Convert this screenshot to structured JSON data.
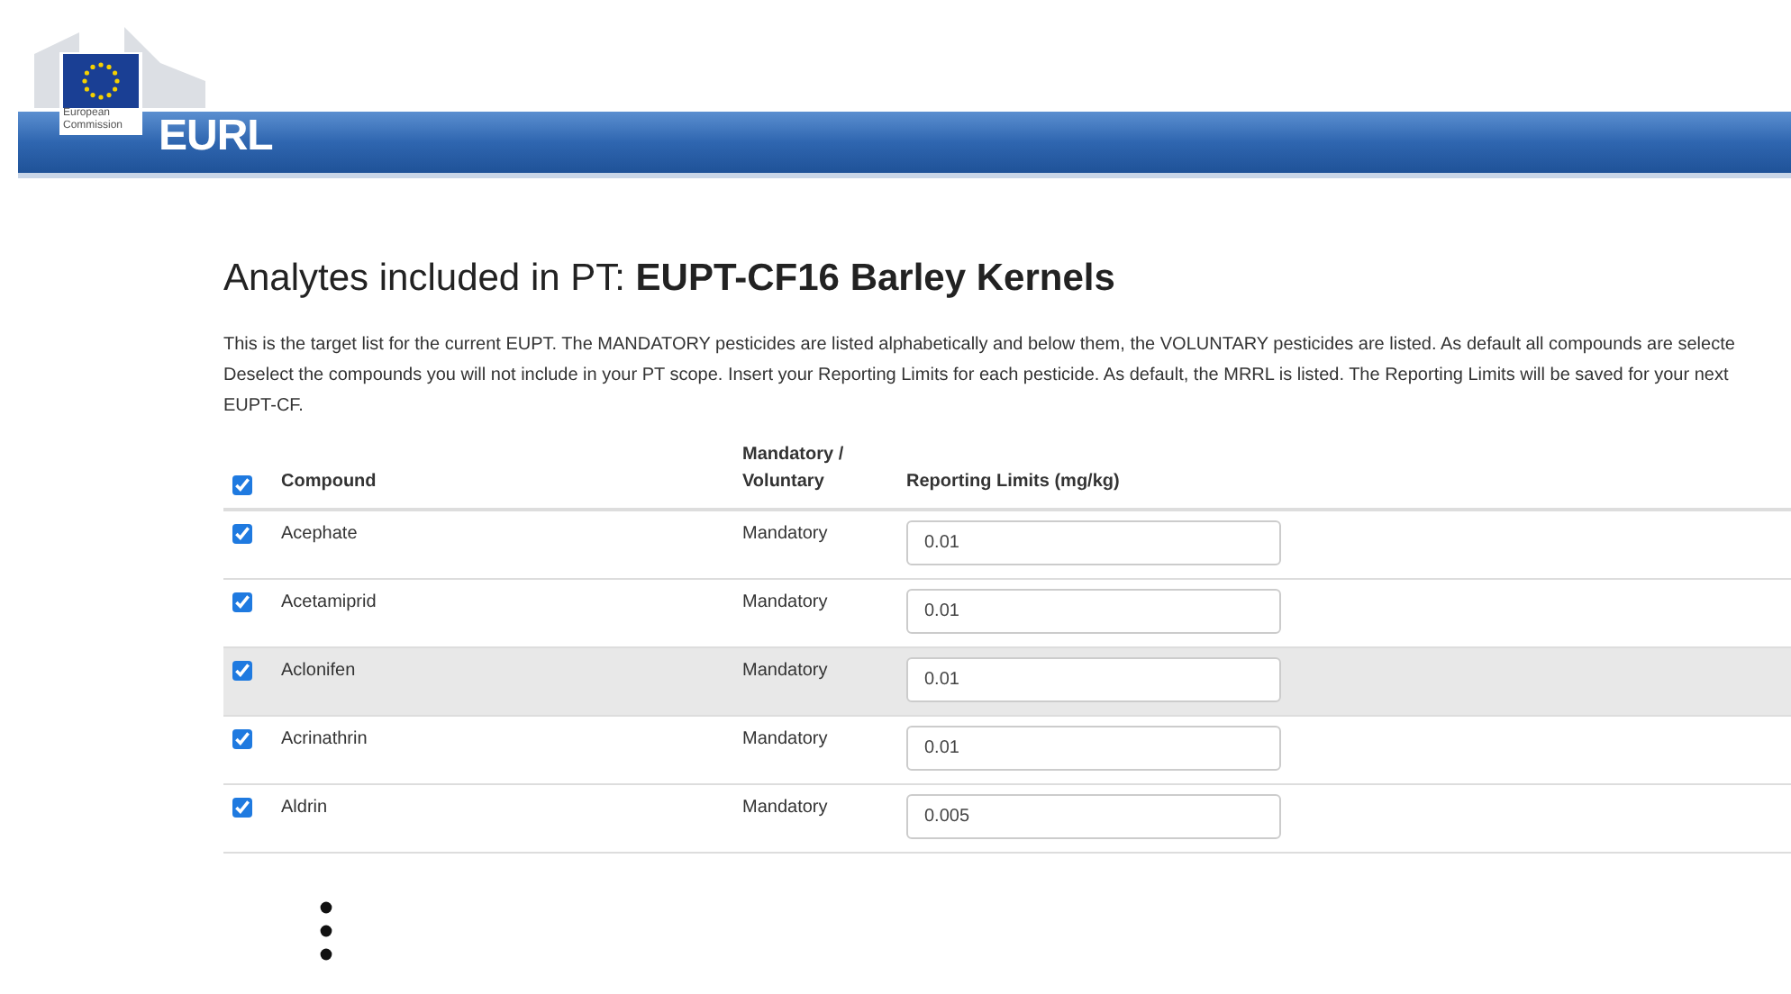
{
  "header": {
    "logo_caption": "European Commission",
    "brand": "EURL"
  },
  "title": {
    "prefix": "Analytes included in PT: ",
    "name": "EUPT-CF16 Barley Kernels"
  },
  "intro_lines": [
    "This is the target list for the current EUPT. The MANDATORY pesticides are listed alphabetically and below them, the VOLUNTARY pesticides are listed. As default all compounds are selecte",
    "Deselect the compounds you will not include in your PT scope. Insert your Reporting Limits for each pesticide. As default, the MRRL is listed. The Reporting Limits will be saved for your next",
    "EUPT-CF."
  ],
  "table": {
    "select_all_checked": true,
    "columns": [
      "Compound",
      "Mandatory / Voluntary",
      "Reporting Limits (mg/kg)"
    ],
    "rows": [
      {
        "checked": true,
        "compound": "Acephate",
        "type": "Mandatory",
        "limit": "0.01",
        "highlighted": false
      },
      {
        "checked": true,
        "compound": "Acetamiprid",
        "type": "Mandatory",
        "limit": "0.01",
        "highlighted": false
      },
      {
        "checked": true,
        "compound": "Aclonifen",
        "type": "Mandatory",
        "limit": "0.01",
        "highlighted": true
      },
      {
        "checked": true,
        "compound": "Acrinathrin",
        "type": "Mandatory",
        "limit": "0.01",
        "highlighted": false
      },
      {
        "checked": true,
        "compound": "Aldrin",
        "type": "Mandatory",
        "limit": "0.005",
        "highlighted": false
      }
    ]
  }
}
